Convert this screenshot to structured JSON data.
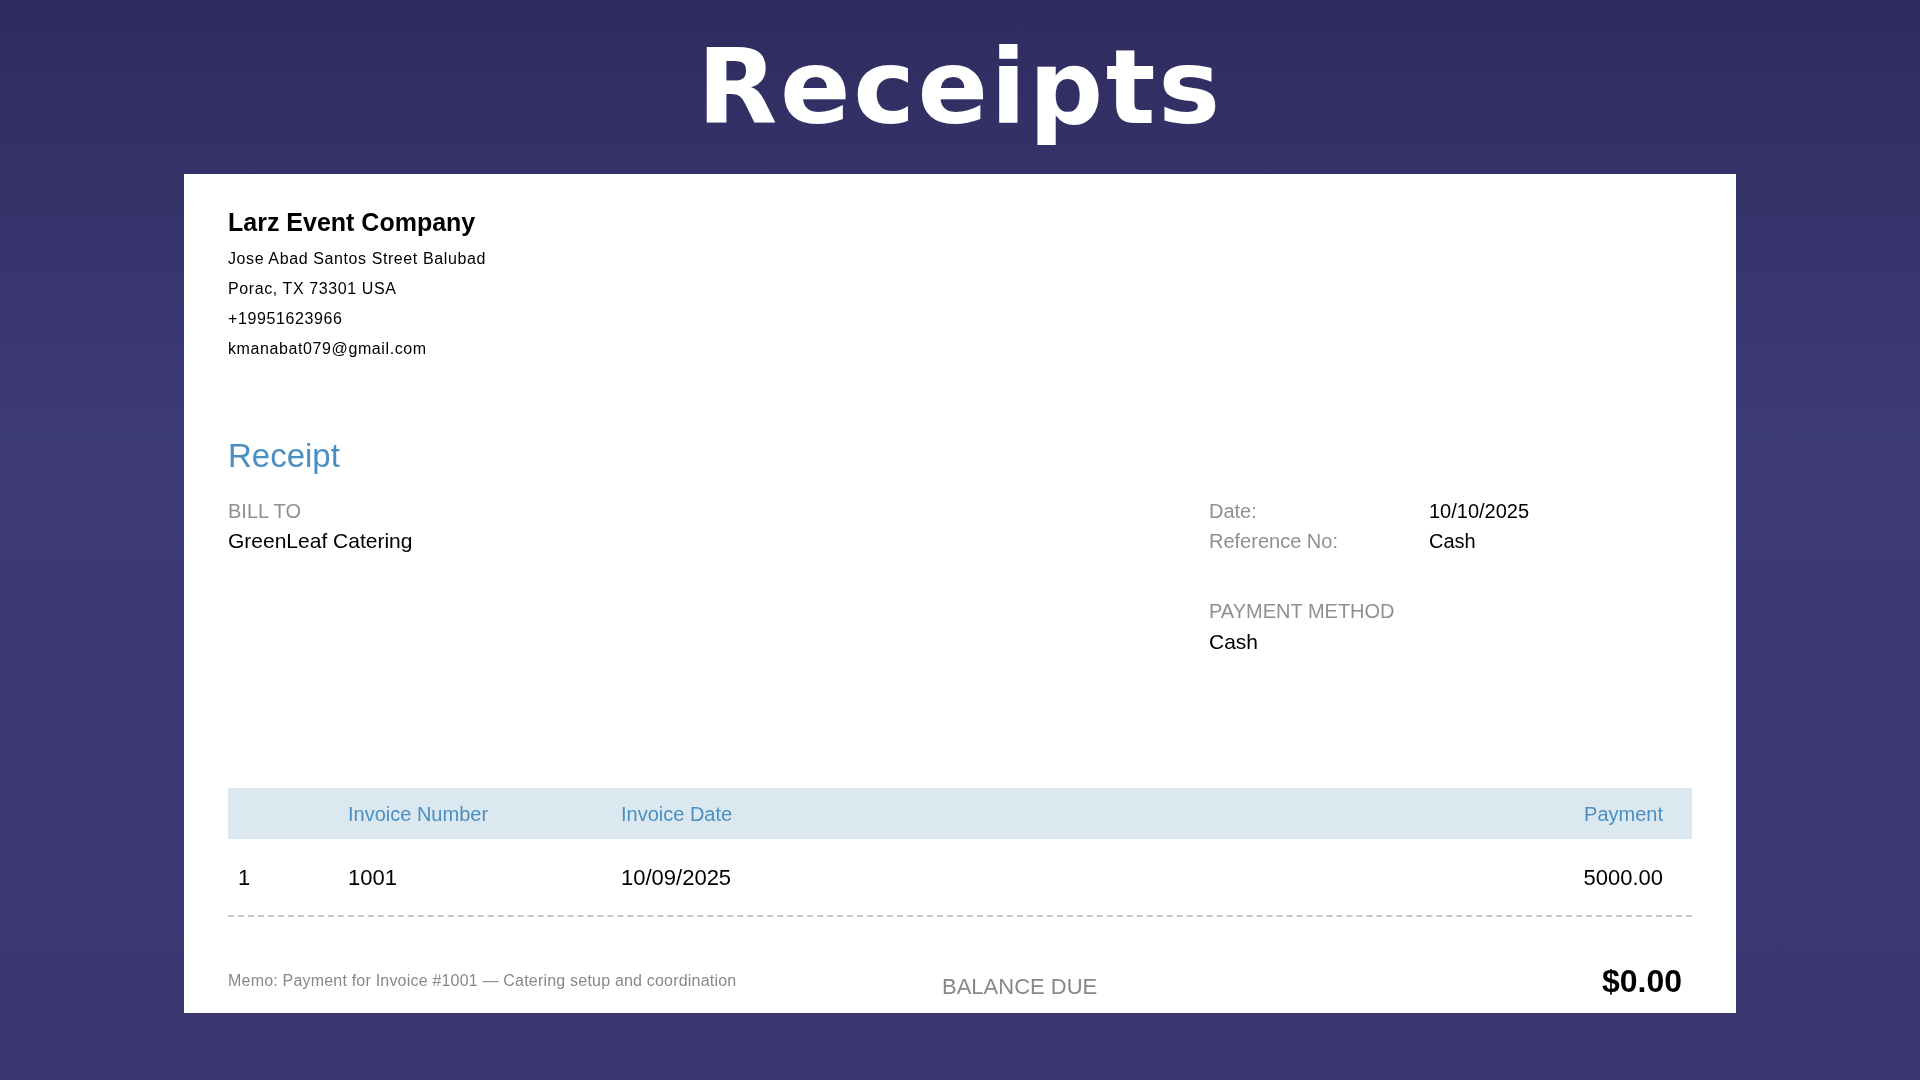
{
  "slide_title": "Receipts",
  "company": {
    "name": "Larz Event Company",
    "lines": [
      "Jose Abad Santos Street Balubad",
      "Porac, TX  73301 USA",
      "+19951623966",
      "kmanabat079@gmail.com"
    ]
  },
  "receipt": {
    "heading": "Receipt",
    "bill_to_label": "BILL TO",
    "bill_to": "GreenLeaf Catering",
    "details": [
      {
        "label": "Date:",
        "value": "10/10/2025"
      },
      {
        "label": "Reference No:",
        "value": "Cash"
      }
    ],
    "payment_method_label": "PAYMENT METHOD",
    "payment_method": "Cash"
  },
  "table": {
    "columns": [
      "",
      "Invoice Number",
      "Invoice Date",
      "Payment"
    ],
    "rows": [
      [
        "1",
        "1001",
        "10/09/2025",
        "5000.00"
      ]
    ]
  },
  "memo": "Memo: Payment for Invoice #1001 — Catering setup and coordination",
  "balance_due_label": "BALANCE DUE",
  "balance_due": "$0.00"
}
